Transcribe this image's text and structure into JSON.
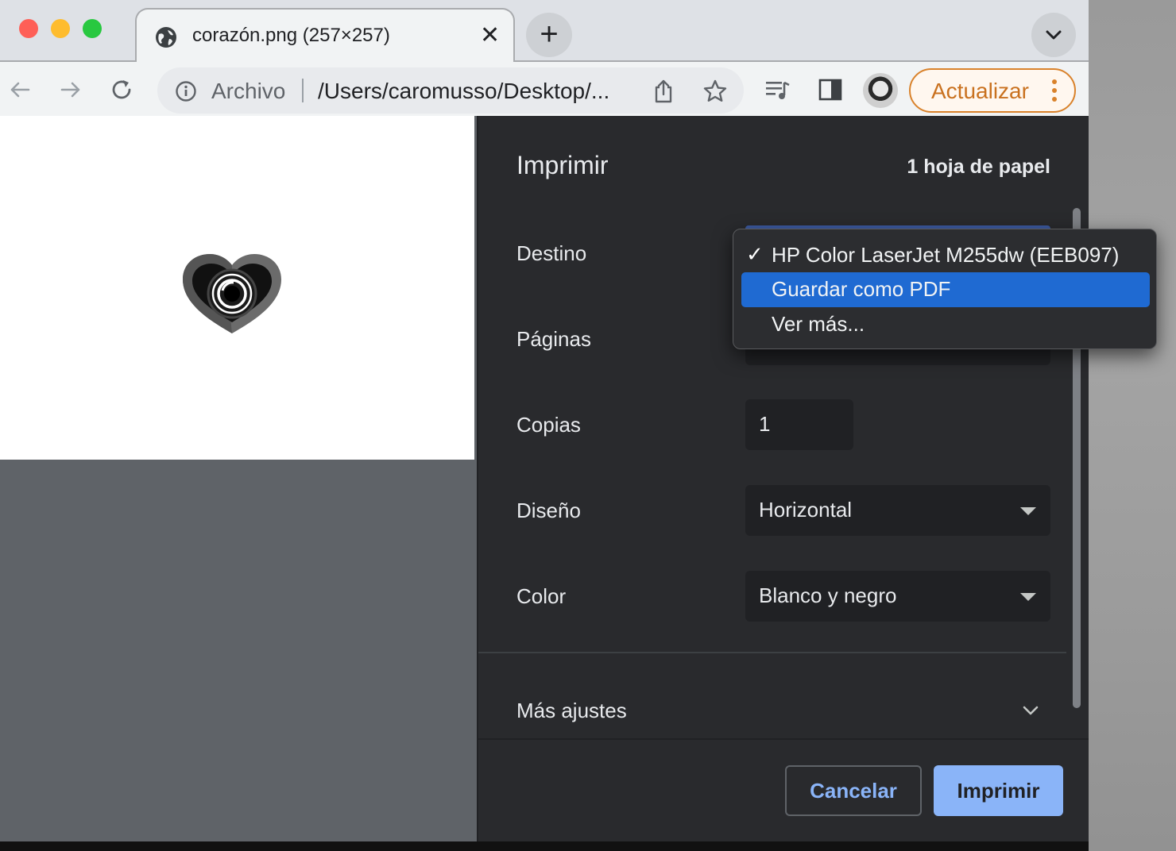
{
  "browser": {
    "tab": {
      "title": "corazón.png (257×257)",
      "close_glyph": "✕",
      "favicon": "globe-icon"
    },
    "new_tab_glyph": "+",
    "toolbar": {
      "omnibox": {
        "scheme_label": "Archivo",
        "url": "/Users/caromusso/Desktop/..."
      },
      "update_label": "Actualizar"
    }
  },
  "print_dialog": {
    "title": "Imprimir",
    "sheet_count": "1 hoja de papel",
    "rows": {
      "destino": {
        "label": "Destino"
      },
      "paginas": {
        "label": "Páginas"
      },
      "copias": {
        "label": "Copias",
        "value": "1"
      },
      "diseno": {
        "label": "Diseño",
        "value": "Horizontal"
      },
      "color": {
        "label": "Color",
        "value": "Blanco y negro"
      }
    },
    "more_settings": "Más ajustes",
    "buttons": {
      "cancel": "Cancelar",
      "print": "Imprimir"
    },
    "destination_menu": {
      "check_glyph": "✓",
      "items": [
        {
          "label": "HP Color LaserJet M255dw (EEB097)",
          "checked": true
        },
        {
          "label": "Guardar como PDF",
          "highlighted": true
        },
        {
          "label": "Ver más..."
        }
      ]
    }
  },
  "colors": {
    "accent_blue": "#8ab4f8",
    "menu_highlight": "#1f6ad2",
    "update_orange": "#d9822b",
    "panel_bg": "#292a2d"
  }
}
